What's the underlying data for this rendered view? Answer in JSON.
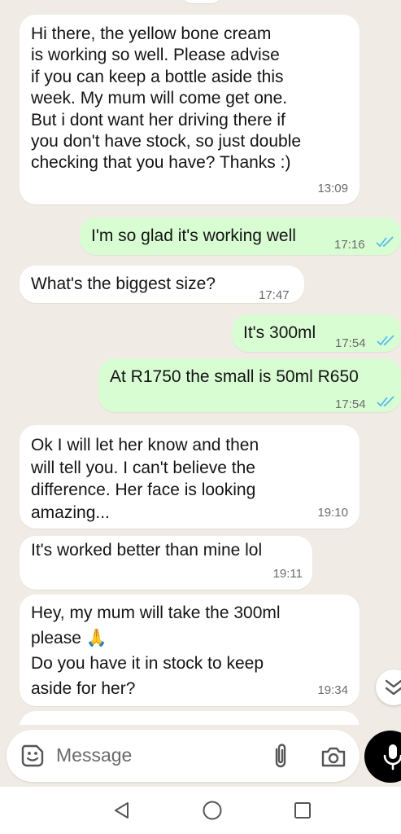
{
  "messages": [
    {
      "direction": "incoming",
      "text": "Hi there, the yellow bone cream\nis working so well. Please advise\nif you can keep a bottle aside this\nweek. My mum will come get one.\nBut i dont want her driving there if\nyou don't have stock, so just double\nchecking that you have? Thanks :)",
      "time": "13:09"
    },
    {
      "direction": "outgoing",
      "text": "I'm so glad it's working well",
      "time": "17:16",
      "status": "read"
    },
    {
      "direction": "incoming",
      "text": "What's the biggest size?",
      "time": "17:47"
    },
    {
      "direction": "outgoing",
      "text": "It's 300ml",
      "time": "17:54",
      "status": "read"
    },
    {
      "direction": "outgoing",
      "text": "At R1750 the small is 50ml R650",
      "time": "17:54",
      "status": "read"
    },
    {
      "direction": "incoming",
      "text": "Ok I will let her know and then\nwill tell you. I can't believe the\ndifference. Her face is looking\namazing...",
      "time": "19:10"
    },
    {
      "direction": "incoming",
      "text": "It's worked better than mine lol",
      "time": "19:11"
    },
    {
      "direction": "incoming",
      "text": "Hey, my mum will take the 300ml\nplease 🙏\nDo you have it in stock to keep\naside for her?",
      "time": "19:34"
    }
  ],
  "input": {
    "placeholder": "Message"
  },
  "icons": {
    "emoji": "sticker-smiley-icon",
    "attach": "paperclip-icon",
    "camera": "camera-icon",
    "mic": "microphone-icon",
    "scroll": "double-chevron-down-icon",
    "nav_back": "triangle-back-icon",
    "nav_home": "circle-home-icon",
    "nav_recents": "square-recents-icon"
  },
  "colors": {
    "incoming_bubble": "#ffffff",
    "outgoing_bubble": "#d9fdd3",
    "read_tick": "#53bdeb",
    "background": "#f0ebe4"
  }
}
